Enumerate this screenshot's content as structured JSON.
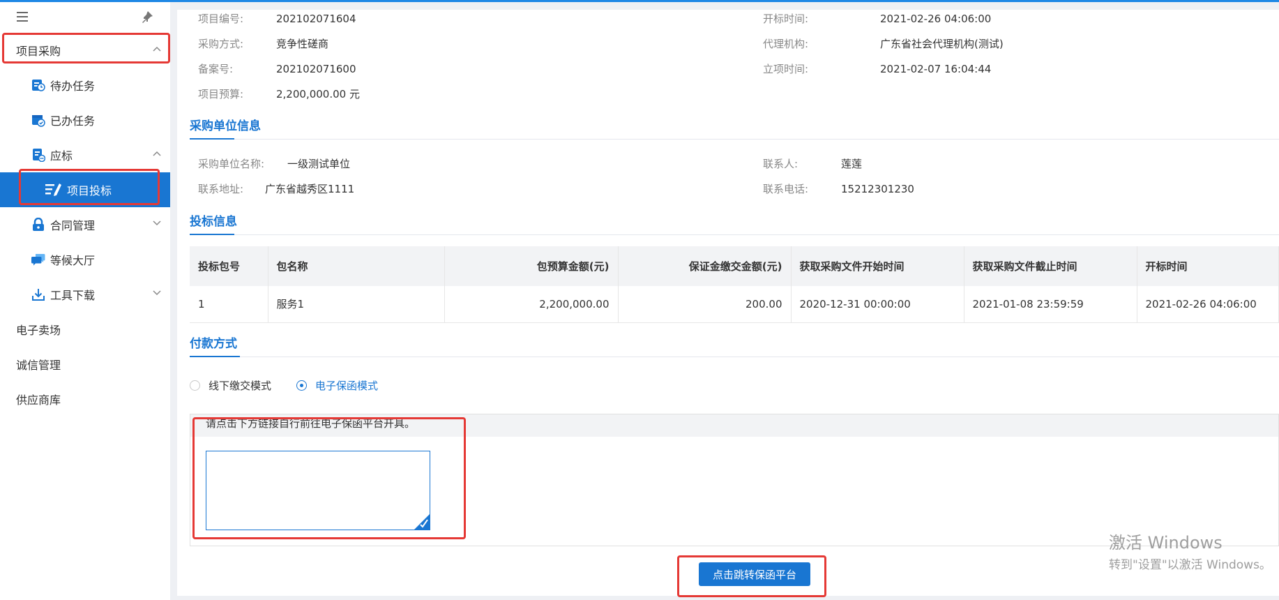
{
  "sidebar": {
    "items": [
      {
        "label": "项目采购"
      },
      {
        "label": "待办任务"
      },
      {
        "label": "已办任务"
      },
      {
        "label": "应标"
      },
      {
        "label": "项目投标"
      },
      {
        "label": "合同管理"
      },
      {
        "label": "等候大厅"
      },
      {
        "label": "工具下载"
      },
      {
        "label": "电子卖场"
      },
      {
        "label": "诚信管理"
      },
      {
        "label": "供应商库"
      }
    ]
  },
  "project": {
    "number_label": "项目编号:",
    "number": "202102071604",
    "method_label": "采购方式:",
    "method": "竞争性磋商",
    "record_label": "备案号:",
    "record": "202102071600",
    "budget_label": "项目预算:",
    "budget": "2,200,000.00 元",
    "open_time_label": "开标时间:",
    "open_time": "2021-02-26 04:06:00",
    "agency_label": "代理机构:",
    "agency": "广东省社会代理机构(测试)",
    "setup_time_label": "立项时间:",
    "setup_time": "2021-02-07 16:04:44"
  },
  "buyer": {
    "title": "采购单位信息",
    "name_label": "采购单位名称:",
    "name": "一级测试单位",
    "contact_label": "联系人:",
    "contact": "莲莲",
    "address_label": "联系地址:",
    "address": "广东省越秀区1111",
    "phone_label": "联系电话:",
    "phone": "15212301230"
  },
  "bid": {
    "title": "投标信息",
    "columns": [
      "投标包号",
      "包名称",
      "包预算金额(元)",
      "保证金缴交金额(元)",
      "获取采购文件开始时间",
      "获取采购文件截止时间",
      "开标时间"
    ],
    "rows": [
      [
        "1",
        "服务1",
        "2,200,000.00",
        "200.00",
        "2020-12-31 00:00:00",
        "2021-01-08 23:59:59",
        "2021-02-26 04:06:00"
      ]
    ]
  },
  "payment": {
    "title": "付款方式",
    "options": [
      "线下缴交模式",
      "电子保函模式"
    ],
    "selected": "电子保函模式",
    "hint": "请点击下方链接自行前往电子保函平台开具。",
    "button": "点击跳转保函平台"
  },
  "watermark": {
    "line1": "激活 Windows",
    "line2": "转到\"设置\"以激活 Windows。"
  },
  "colors": {
    "accent": "#1976d2",
    "highlight": "#e53935"
  }
}
